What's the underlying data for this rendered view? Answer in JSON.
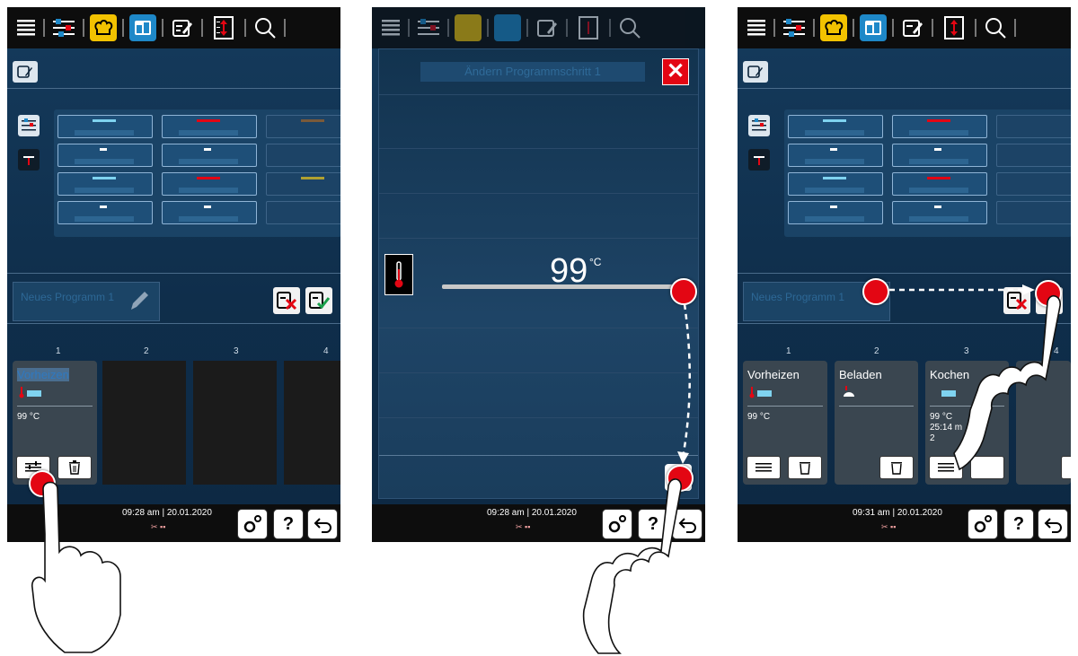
{
  "colors": {
    "accent": "#e30613",
    "topbar": "#0d0d0d",
    "screen_bg": "#0f2e4b",
    "tile_yellow": "#f2c200",
    "tile_blue": "#1e88c8"
  },
  "screen1": {
    "program_name": "Neues Programm 1",
    "columns": [
      "1",
      "2",
      "3",
      "4"
    ],
    "step1": {
      "title": "Vorheizen",
      "temp": "99 °C"
    },
    "time": "09:28 am | 20.01.2020",
    "help_label": "?"
  },
  "screen2": {
    "dialog_title": "Ändern Programmschritt 1",
    "close_label": "✕",
    "temperature": "99",
    "temperature_unit": "°C",
    "time": "09:28 am | 20.01.2020",
    "help_label": "?"
  },
  "screen3": {
    "program_name": "Neues Programm 1",
    "columns": [
      "1",
      "2",
      "3",
      "4"
    ],
    "steps": [
      {
        "title": "Vorheizen",
        "line1": "99 °C",
        "line2": "",
        "line3": ""
      },
      {
        "title": "Beladen",
        "line1": "",
        "line2": "",
        "line3": ""
      },
      {
        "title": "Kochen",
        "line1": "99 °C",
        "line2": "25:14 m",
        "line3": "2"
      }
    ],
    "time": "09:31 am | 20.01.2020",
    "help_label": "?"
  }
}
